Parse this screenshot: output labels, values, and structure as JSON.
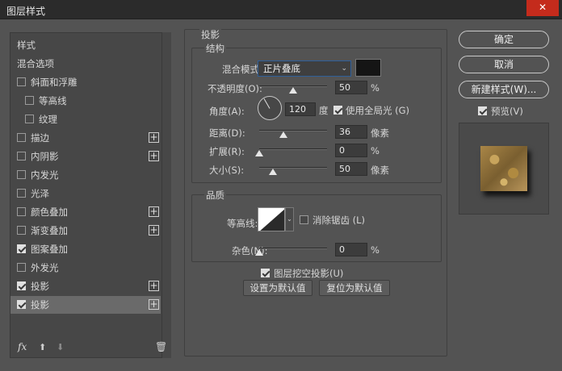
{
  "window": {
    "title": "图层样式",
    "close_glyph": "✕"
  },
  "sidebar": {
    "header": "样式",
    "items": [
      {
        "label": "混合选项",
        "checkbox": false,
        "checked": false,
        "plus": false,
        "indent": false
      },
      {
        "label": "斜面和浮雕",
        "checkbox": true,
        "checked": false,
        "plus": false,
        "indent": false
      },
      {
        "label": "等高线",
        "checkbox": true,
        "checked": false,
        "plus": false,
        "indent": true
      },
      {
        "label": "纹理",
        "checkbox": true,
        "checked": false,
        "plus": false,
        "indent": true
      },
      {
        "label": "描边",
        "checkbox": true,
        "checked": false,
        "plus": true,
        "indent": false
      },
      {
        "label": "内阴影",
        "checkbox": true,
        "checked": false,
        "plus": true,
        "indent": false
      },
      {
        "label": "内发光",
        "checkbox": true,
        "checked": false,
        "plus": false,
        "indent": false
      },
      {
        "label": "光泽",
        "checkbox": true,
        "checked": false,
        "plus": false,
        "indent": false
      },
      {
        "label": "颜色叠加",
        "checkbox": true,
        "checked": false,
        "plus": true,
        "indent": false
      },
      {
        "label": "渐变叠加",
        "checkbox": true,
        "checked": false,
        "plus": true,
        "indent": false
      },
      {
        "label": "图案叠加",
        "checkbox": true,
        "checked": true,
        "plus": false,
        "indent": false
      },
      {
        "label": "外发光",
        "checkbox": true,
        "checked": false,
        "plus": false,
        "indent": false
      },
      {
        "label": "投影",
        "checkbox": true,
        "checked": true,
        "plus": true,
        "indent": false
      },
      {
        "label": "投影",
        "checkbox": true,
        "checked": true,
        "plus": true,
        "indent": false,
        "active": true
      }
    ],
    "footer": {
      "fx_label": "fx",
      "up_glyph": "⬆",
      "down_glyph": "⬇",
      "trash_glyph": "🗑"
    }
  },
  "drop_shadow": {
    "section_title": "投影",
    "structure": {
      "title": "结构",
      "blend_mode_label": "混合模式:",
      "blend_mode_value": "正片叠底",
      "blend_color": "#151515",
      "opacity_label": "不透明度(O):",
      "opacity_value": "50",
      "opacity_unit": "%",
      "angle_label": "角度(A):",
      "angle_value": "120",
      "angle_unit": "度",
      "global_light_label": "使用全局光 (G)",
      "global_light_checked": true,
      "distance_label": "距离(D):",
      "distance_value": "36",
      "distance_unit": "像素",
      "spread_label": "扩展(R):",
      "spread_value": "0",
      "spread_unit": "%",
      "size_label": "大小(S):",
      "size_value": "50",
      "size_unit": "像素"
    },
    "quality": {
      "title": "品质",
      "contour_label": "等高线:",
      "anti_alias_label": "消除锯齿 (L)",
      "anti_alias_checked": false,
      "noise_label": "杂色(N):",
      "noise_value": "0",
      "noise_unit": "%"
    },
    "knockout_label": "图层挖空投影(U)",
    "knockout_checked": true,
    "make_default_label": "设置为默认值",
    "reset_default_label": "复位为默认值"
  },
  "buttons": {
    "ok": "确定",
    "cancel": "取消",
    "new_style": "新建样式(W)...",
    "preview_label": "预览(V)",
    "preview_checked": true
  }
}
